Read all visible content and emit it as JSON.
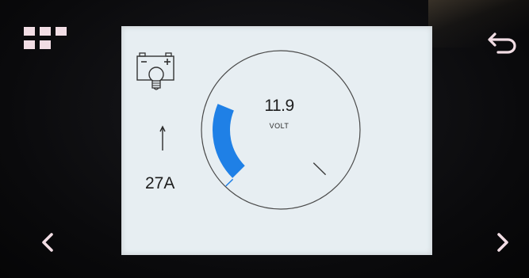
{
  "display": {
    "current": "27A",
    "current_direction_icon": "arrow-up-icon",
    "battery_icon": "battery-lightbulb-icon",
    "voltage": {
      "value": "11.9",
      "unit": "VOLT",
      "level_fraction": 0.25
    }
  },
  "navigation": {
    "menu_icon": "grid-menu-icon",
    "back_icon": "return-arrow-icon",
    "prev_icon": "chevron-left-icon",
    "next_icon": "chevron-right-icon"
  },
  "colors": {
    "gauge_fill": "#1f80e6",
    "screen_background": "#e7eef2",
    "bezel": "#0b0b0d",
    "nav_icon": "#f1dde4"
  }
}
